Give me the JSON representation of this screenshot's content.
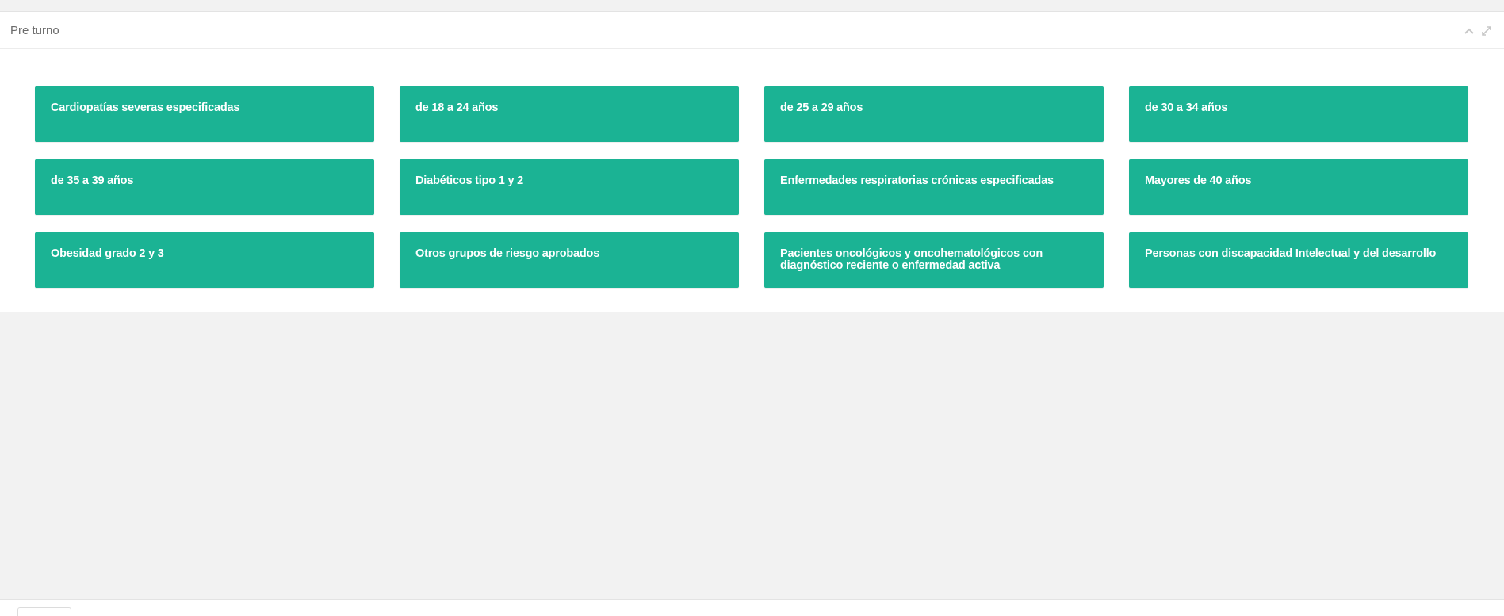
{
  "panel": {
    "title": "Pre turno",
    "tools": [
      {
        "name": "collapse",
        "icon": "chevron-up-icon"
      },
      {
        "name": "expand",
        "icon": "expand-icon"
      }
    ]
  },
  "tiles": [
    "Cardiopatías severas especificadas",
    "de 18 a 24 años",
    "de 25 a 29 años",
    "de 30 a 34 años",
    "de 35 a 39 años",
    "Diabéticos tipo 1 y 2",
    "Enfermedades respiratorias crónicas especificadas",
    "Mayores de 40 años",
    "Obesidad grado 2 y 3",
    "Otros grupos de riesgo aprobados",
    "Pacientes oncológicos y oncohematológicos con diagnóstico reciente o enfermedad activa",
    "Personas con discapacidad Intelectual y del desarrollo"
  ],
  "colors": {
    "tile_bg": "#1bb394",
    "page_bg": "#f2f2f2",
    "panel_bg": "#ffffff"
  }
}
